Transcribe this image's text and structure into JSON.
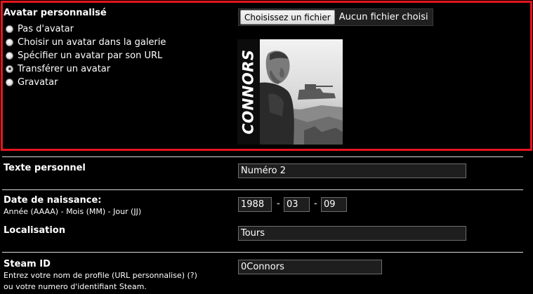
{
  "avatar": {
    "title": "Avatar personnalisé",
    "options": [
      {
        "label": "Pas d'avatar",
        "checked": false
      },
      {
        "label": "Choisir un avatar dans la galerie",
        "checked": false
      },
      {
        "label": "Spécifier un avatar par son URL",
        "checked": false
      },
      {
        "label": "Transférer un avatar",
        "checked": true
      },
      {
        "label": "Gravatar",
        "checked": false
      }
    ],
    "file_button": "Choisissez un fichier",
    "file_status": "Aucun fichier choisi",
    "image_caption": "CONNORS",
    "highlight_color": "#e3151e"
  },
  "personal_text": {
    "label": "Texte personnel",
    "value": "Numéro 2"
  },
  "birthdate": {
    "label": "Date de naissance:",
    "hint": "Année (AAAA) - Mois (MM) - Jour (JJ)",
    "year": "1988",
    "month": "03",
    "day": "09",
    "separator": "-"
  },
  "location": {
    "label": "Localisation",
    "value": "Tours"
  },
  "steam": {
    "label": "Steam ID",
    "hint_line1": "Entrez votre nom de profile (URL personnalise) (?)",
    "hint_line2": "ou votre numero d'identifiant Steam.",
    "value": "0Connors"
  }
}
